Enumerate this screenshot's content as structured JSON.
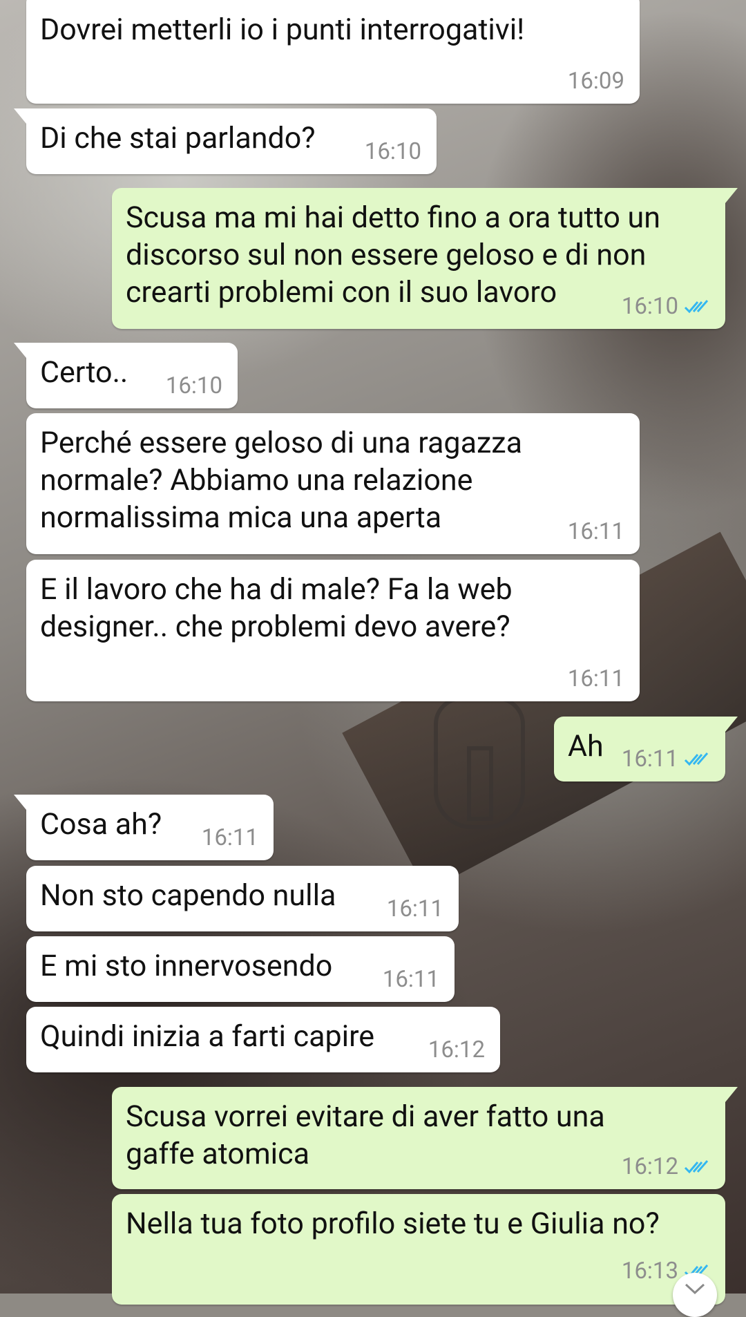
{
  "messages": [
    {
      "dir": "in",
      "text": "Dovrei metterli io i punti interrogativi!",
      "time": "16:09"
    },
    {
      "dir": "in",
      "text": "Di che stai parlando?",
      "time": "16:10"
    },
    {
      "dir": "out",
      "text": "Scusa ma mi hai detto fino a ora tutto un\ndiscorso sul non essere geloso e di non\ncrearti problemi con il suo lavoro",
      "time": "16:10",
      "status": "read"
    },
    {
      "dir": "in",
      "text": "Certo..",
      "time": "16:10"
    },
    {
      "dir": "in",
      "text": "Perché essere geloso di una ragazza\nnormale? Abbiamo una relazione\nnormalissima mica una aperta",
      "time": "16:11"
    },
    {
      "dir": "in",
      "text": "E il lavoro che ha di male? Fa la web\ndesigner.. che problemi devo avere?",
      "time": "16:11"
    },
    {
      "dir": "out",
      "text": "Ah",
      "time": "16:11",
      "status": "read"
    },
    {
      "dir": "in",
      "text": "Cosa ah?",
      "time": "16:11"
    },
    {
      "dir": "in",
      "text": "Non sto capendo nulla",
      "time": "16:11"
    },
    {
      "dir": "in",
      "text": "E mi sto innervosendo",
      "time": "16:11"
    },
    {
      "dir": "in",
      "text": "Quindi inizia a farti capire",
      "time": "16:12"
    },
    {
      "dir": "out",
      "text": "Scusa vorrei evitare di aver fatto una\ngaffe atomica",
      "time": "16:12",
      "status": "read"
    },
    {
      "dir": "out",
      "text": "Nella tua foto profilo siete tu e Giulia no?",
      "time": "16:13",
      "status": "read"
    }
  ],
  "colors": {
    "incoming": "#ffffff",
    "outgoing": "#e1f8c8",
    "read_ticks": "#34b7f1",
    "time": "#8d8d8d"
  },
  "icons": {
    "read_status": "double-check-icon",
    "scroll_down": "chevron-down-icon"
  }
}
